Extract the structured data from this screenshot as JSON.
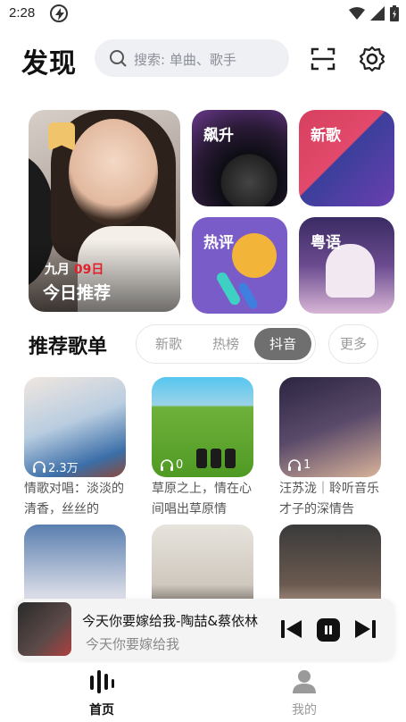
{
  "status": {
    "time": "2:28"
  },
  "header": {
    "logo": "发现",
    "search_placeholder": "搜索: 单曲、歌手"
  },
  "feature": {
    "month": "九月",
    "day": "09日",
    "daily_title": "今日推荐",
    "rising": "飙升",
    "new_songs": "新歌",
    "hot_reviews": "热评",
    "cantonese": "粤语"
  },
  "playlists_section": {
    "title": "推荐歌单",
    "tabs": [
      "新歌",
      "热榜",
      "抖音"
    ],
    "active_tab": "抖音",
    "more": "更多",
    "items": [
      {
        "count": "2.3万",
        "title": "情歌对唱：淡淡的清香，丝丝的"
      },
      {
        "count": "0",
        "title": "草原之上，情在心间唱出草原情"
      },
      {
        "count": "1",
        "title": "汪苏泷｜聆听音乐才子的深情告"
      },
      {
        "count": "",
        "title": ""
      },
      {
        "count": "",
        "title": ""
      },
      {
        "count": "",
        "title": ""
      }
    ]
  },
  "player": {
    "title": "今天你要嫁给我-陶喆&蔡依林",
    "lyric": "今天你要嫁给我"
  },
  "bottom_nav": {
    "home": "首页",
    "mine": "我的"
  },
  "colors": {
    "accent_red": "#e2202c",
    "active_tab_bg": "#6f6f6f"
  }
}
